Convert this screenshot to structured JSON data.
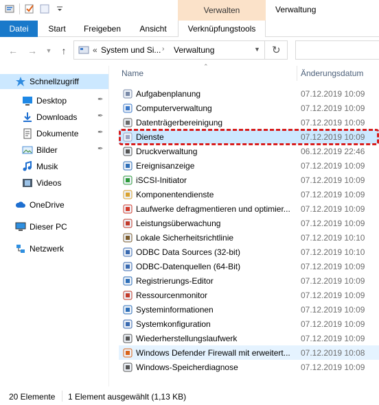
{
  "context_tab_group": "Verwalten",
  "window_title": "Verwaltung",
  "ribbon_tabs": [
    "Datei",
    "Start",
    "Freigeben",
    "Ansicht",
    "Verknüpfungstools"
  ],
  "breadcrumb": {
    "overflow": "«",
    "parts": [
      "System und Si...",
      "Verwaltung"
    ]
  },
  "navigation": [
    {
      "label": "Schnellzugriff",
      "icon": "star-icon",
      "selected": true
    },
    {
      "label": "Desktop",
      "icon": "desktop-folder-icon",
      "pinned": true
    },
    {
      "label": "Downloads",
      "icon": "downloads-folder-icon",
      "pinned": true
    },
    {
      "label": "Dokumente",
      "icon": "documents-folder-icon",
      "pinned": true
    },
    {
      "label": "Bilder",
      "icon": "pictures-folder-icon",
      "pinned": true
    },
    {
      "label": "Musik",
      "icon": "music-icon"
    },
    {
      "label": "Videos",
      "icon": "videos-icon"
    },
    {
      "label": "OneDrive",
      "icon": "cloud-icon"
    },
    {
      "label": "Dieser PC",
      "icon": "computer-icon"
    },
    {
      "label": "Netzwerk",
      "icon": "network-icon"
    }
  ],
  "columns": {
    "name": "Name",
    "date": "Änderungsdatum"
  },
  "files": [
    {
      "name": "Aufgabenplanung",
      "date": "07.12.2019 10:09"
    },
    {
      "name": "Computerverwaltung",
      "date": "07.12.2019 10:09"
    },
    {
      "name": "Datenträgerbereinigung",
      "date": "07.12.2019 10:09"
    },
    {
      "name": "Dienste",
      "date": "07.12.2019 10:09",
      "selected": true
    },
    {
      "name": "Druckverwaltung",
      "date": "06.12.2019 22:46"
    },
    {
      "name": "Ereignisanzeige",
      "date": "07.12.2019 10:09"
    },
    {
      "name": "iSCSI-Initiator",
      "date": "07.12.2019 10:09"
    },
    {
      "name": "Komponentendienste",
      "date": "07.12.2019 10:09"
    },
    {
      "name": "Laufwerke defragmentieren und optimier...",
      "date": "07.12.2019 10:09"
    },
    {
      "name": "Leistungsüberwachung",
      "date": "07.12.2019 10:09"
    },
    {
      "name": "Lokale Sicherheitsrichtlinie",
      "date": "07.12.2019 10:10"
    },
    {
      "name": "ODBC Data Sources (32-bit)",
      "date": "07.12.2019 10:10"
    },
    {
      "name": "ODBC-Datenquellen (64-Bit)",
      "date": "07.12.2019 10:09"
    },
    {
      "name": "Registrierungs-Editor",
      "date": "07.12.2019 10:09"
    },
    {
      "name": "Ressourcenmonitor",
      "date": "07.12.2019 10:09"
    },
    {
      "name": "Systeminformationen",
      "date": "07.12.2019 10:09"
    },
    {
      "name": "Systemkonfiguration",
      "date": "07.12.2019 10:09"
    },
    {
      "name": "Wiederherstellungslaufwerk",
      "date": "07.12.2019 10:09"
    },
    {
      "name": "Windows Defender Firewall mit erweitert...",
      "date": "07.12.2019 10:08",
      "hover": true
    },
    {
      "name": "Windows-Speicherdiagnose",
      "date": "07.12.2019 10:09"
    }
  ],
  "status": {
    "count": "20 Elemente",
    "selection": "1 Element ausgewählt (1,13 KB)"
  },
  "colors": {
    "accent": "#1979ca",
    "context_tab": "#fbe2c9",
    "selection": "#cce8ff",
    "highlight_border": "#d81d1d"
  }
}
